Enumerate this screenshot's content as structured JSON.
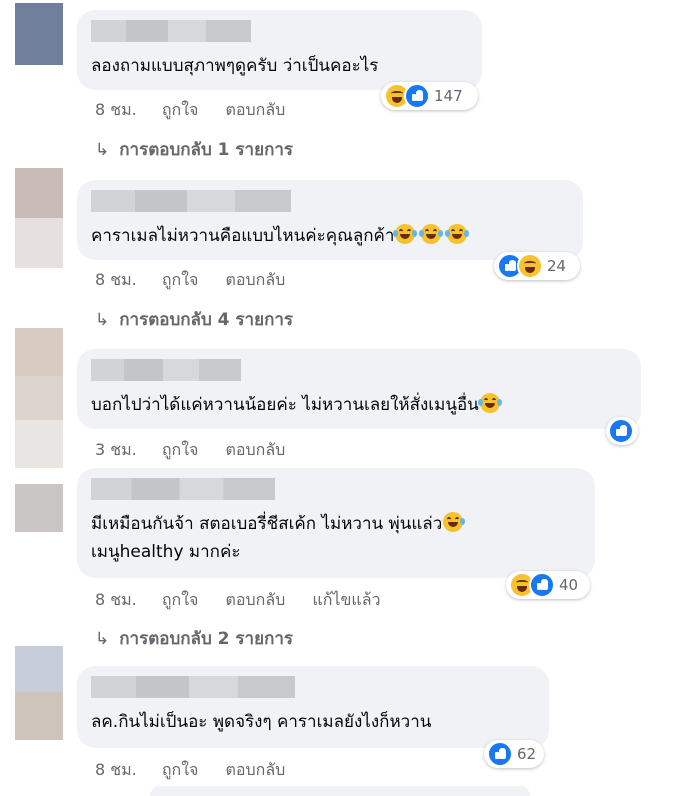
{
  "comments": [
    {
      "text": "ลองถามแบบสุภาพๆดูครับ ว่าเป็นคอะไร",
      "reactions": [
        "haha-icon",
        "like-icon"
      ],
      "count": "147",
      "time": "8 ชม.",
      "like": "ถูกใจ",
      "reply": "ตอบกลับ",
      "edited": "",
      "replies_label": "การตอบกลับ 1 รายการ"
    },
    {
      "text": "คาราเมลไม่หวานคือแบบไหนค่ะคุณลูกค้า",
      "reactions": [
        "like-icon",
        "haha-icon"
      ],
      "count": "24",
      "time": "8 ชม.",
      "like": "ถูกใจ",
      "reply": "ตอบกลับ",
      "edited": "",
      "replies_label": "การตอบกลับ 4 รายการ"
    },
    {
      "text": "บอกไปว่าได้แค่หวานน้อยค่ะ ไม่หวานเลยให้สั่งเมนูอื่น",
      "reactions": [
        "like-icon"
      ],
      "count": "",
      "time": "3 ชม.",
      "like": "ถูกใจ",
      "reply": "ตอบกลับ",
      "edited": "",
      "replies_label": ""
    },
    {
      "text": "มีเหมือนกันจ้า สตอเบอรี่ชีสเค้ก ไม่หวาน พุ่นแล่ว",
      "text2": "เมนูhealthy มากค่ะ",
      "reactions": [
        "haha-icon",
        "like-icon"
      ],
      "count": "40",
      "time": "8 ชม.",
      "like": "ถูกใจ",
      "reply": "ตอบกลับ",
      "edited": "แก้ไขแล้ว",
      "replies_label": "การตอบกลับ 2 รายการ"
    },
    {
      "text": "ลค.กินไม่เป็นอะ พูดจริงๆ คาราเมลยังไงก็หวาน",
      "reactions": [
        "like-icon"
      ],
      "count": "62",
      "time": "8 ชม.",
      "like": "ถูกใจ",
      "reply": "ตอบกลับ",
      "edited": "",
      "replies_label": ""
    }
  ],
  "colors": {
    "bubble": "#f0f2f5",
    "like": "#1877f2",
    "haha": "#f7c22e",
    "meta": "#65676b"
  }
}
